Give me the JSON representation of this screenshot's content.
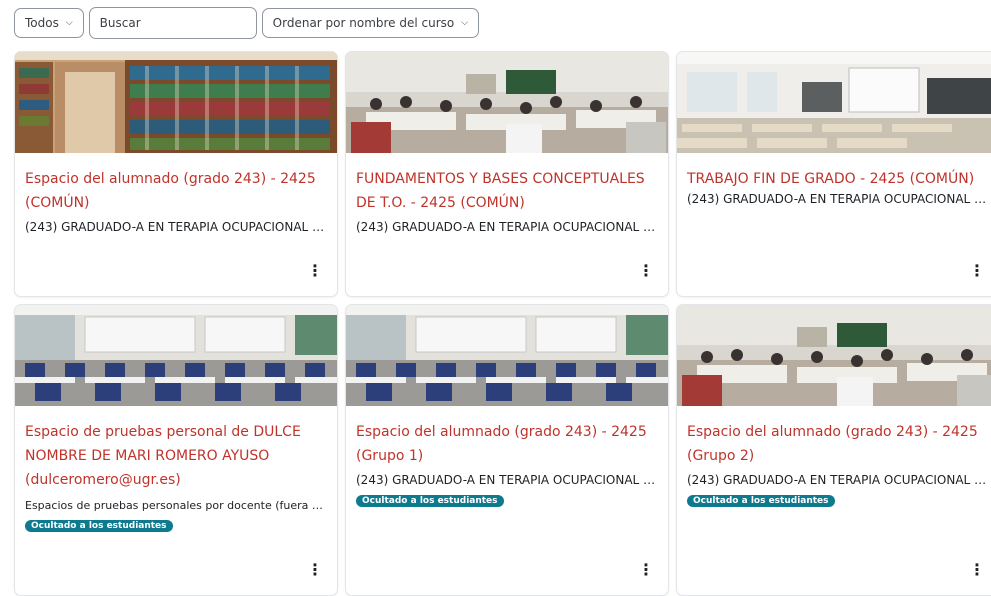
{
  "toolbar": {
    "filter_label": "Todos",
    "search_placeholder": "Buscar",
    "sort_label": "Ordenar por nombre del curso"
  },
  "courses": [
    {
      "title": "Espacio del alumnado (grado 243) - 2425 (COMÚN)",
      "category": "(243) GRADUADO-A EN TERAPIA OCUPACIONAL (…",
      "extra": "",
      "badge": "",
      "thumb": "library"
    },
    {
      "title": "FUNDAMENTOS Y BASES CONCEPTUALES DE T.O. - 2425 (COMÚN)",
      "category": "(243) GRADUADO-A EN TERAPIA OCUPACIONAL (…",
      "extra": "",
      "badge": "",
      "thumb": "students"
    },
    {
      "title": "TRABAJO FIN DE GRADO - 2425 (COMÚN)",
      "category": "(243) GRADUADO-A EN TERAPIA OCUPACIONAL (…",
      "extra": "",
      "badge": "",
      "thumb": "empty-room"
    },
    {
      "title": "Espacio de pruebas personal de DULCE NOMBRE DE MARI ROMERO AYUSO (dulceromero@ugr.es)",
      "category": "",
      "extra": "Espacios de pruebas personales por docente (fuera de P…",
      "badge": "Ocultado a los estudiantes",
      "thumb": "classroom"
    },
    {
      "title": "Espacio del alumnado (grado 243) - 2425 (Grupo 1)",
      "category": "(243) GRADUADO-A EN TERAPIA OCUPACIONAL (…",
      "extra": "",
      "badge": "Ocultado a los estudiantes",
      "thumb": "classroom"
    },
    {
      "title": "Espacio del alumnado (grado 243) - 2425 (Grupo 2)",
      "category": "(243) GRADUADO-A EN TERAPIA OCUPACIONAL (…",
      "extra": "",
      "badge": "Ocultado a los estudiantes",
      "thumb": "students"
    }
  ],
  "icons": {
    "menu": "three-dots-vertical-icon",
    "chevron": "chevron-down-icon"
  },
  "colors": {
    "title": "#c0332b",
    "badge": "#0e7a8f"
  }
}
